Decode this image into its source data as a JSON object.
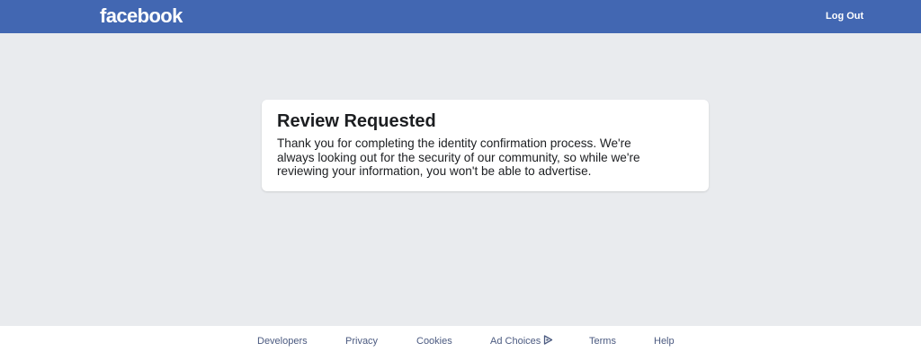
{
  "header": {
    "logo": "facebook",
    "logout_label": "Log Out"
  },
  "card": {
    "title": "Review Requested",
    "lines": [
      "Thank you for completing the identity confirmation process. We're",
      "always looking out for the security of our community, so while we're",
      "reviewing your information, you won't be able to advertise."
    ]
  },
  "footer": {
    "links": [
      "Developers",
      "Privacy",
      "Cookies",
      "Ad Choices",
      "Terms",
      "Help"
    ]
  },
  "icons": {
    "adchoices": "adchoices-icon"
  },
  "colors": {
    "brand": "#4267b2",
    "page_background": "#e9ebee",
    "footer_link": "#4b5a80"
  }
}
